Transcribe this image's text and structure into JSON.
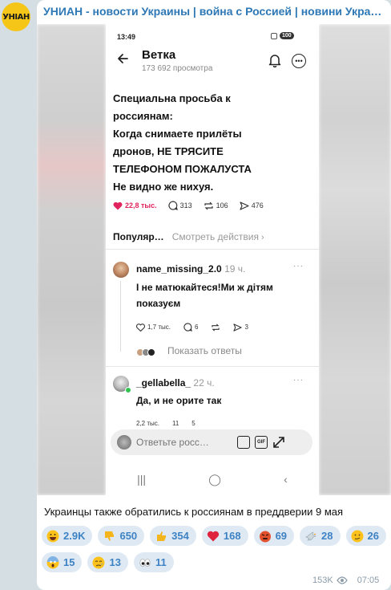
{
  "channel": {
    "name": "УНИАН - новости Украины | война с Россией | новини Украї…",
    "avatar_text": "УНІАН"
  },
  "phone": {
    "status_time": "13:49",
    "battery": "100",
    "thread_title": "Ветка",
    "thread_views": "173 692 просмотра",
    "post_lines": [
      "Специальна просьба к",
      "россиянам:",
      "Когда снимаете прилёты",
      "дронов, НЕ ТРЯСИТЕ",
      "ТЕЛЕФОНОМ ПОЖАЛУСТА",
      "Не видно же нихуя."
    ],
    "actions": {
      "likes": "22,8 тыс.",
      "comments": "313",
      "reposts": "106",
      "shares": "476"
    },
    "tabs": {
      "popular": "Популяр…",
      "activity": "Смотреть действия"
    },
    "comment1": {
      "user": "name_missing_2.0",
      "time": "19 ч.",
      "text": "І не матюкайтеся!Ми ж дітям показуєм",
      "likes": "1,7 тыс.",
      "replies": "6",
      "shares": "3",
      "show_replies": "Показать ответы"
    },
    "comment2": {
      "user": "_gellabella_",
      "time": "22 ч.",
      "text": "Да, и не орите так",
      "likes": "2,2 тыс.",
      "replies": "11",
      "shares": "5"
    },
    "reply_placeholder": "Ответьте росс…",
    "gif_label": "GIF"
  },
  "caption": "Украинцы также обратились к россиянам в преддверии 9 мая",
  "reactions": [
    {
      "emoji": "grinning",
      "count": "2.9K"
    },
    {
      "emoji": "thumbs-down",
      "count": "650"
    },
    {
      "emoji": "thumbs-up",
      "count": "354"
    },
    {
      "emoji": "heart",
      "count": "168"
    },
    {
      "emoji": "angry",
      "count": "69"
    },
    {
      "emoji": "dove",
      "count": "28"
    },
    {
      "emoji": "smirk",
      "count": "26"
    },
    {
      "emoji": "scream",
      "count": "15"
    },
    {
      "emoji": "crying",
      "count": "13"
    },
    {
      "emoji": "eyes",
      "count": "11"
    }
  ],
  "meta": {
    "views": "153K",
    "time": "07:05"
  },
  "colors": {
    "accent": "#2d78b5",
    "reaction_bg": "#dfe9f3",
    "reaction_text": "#3d82c4",
    "like_red": "#e0245e"
  }
}
